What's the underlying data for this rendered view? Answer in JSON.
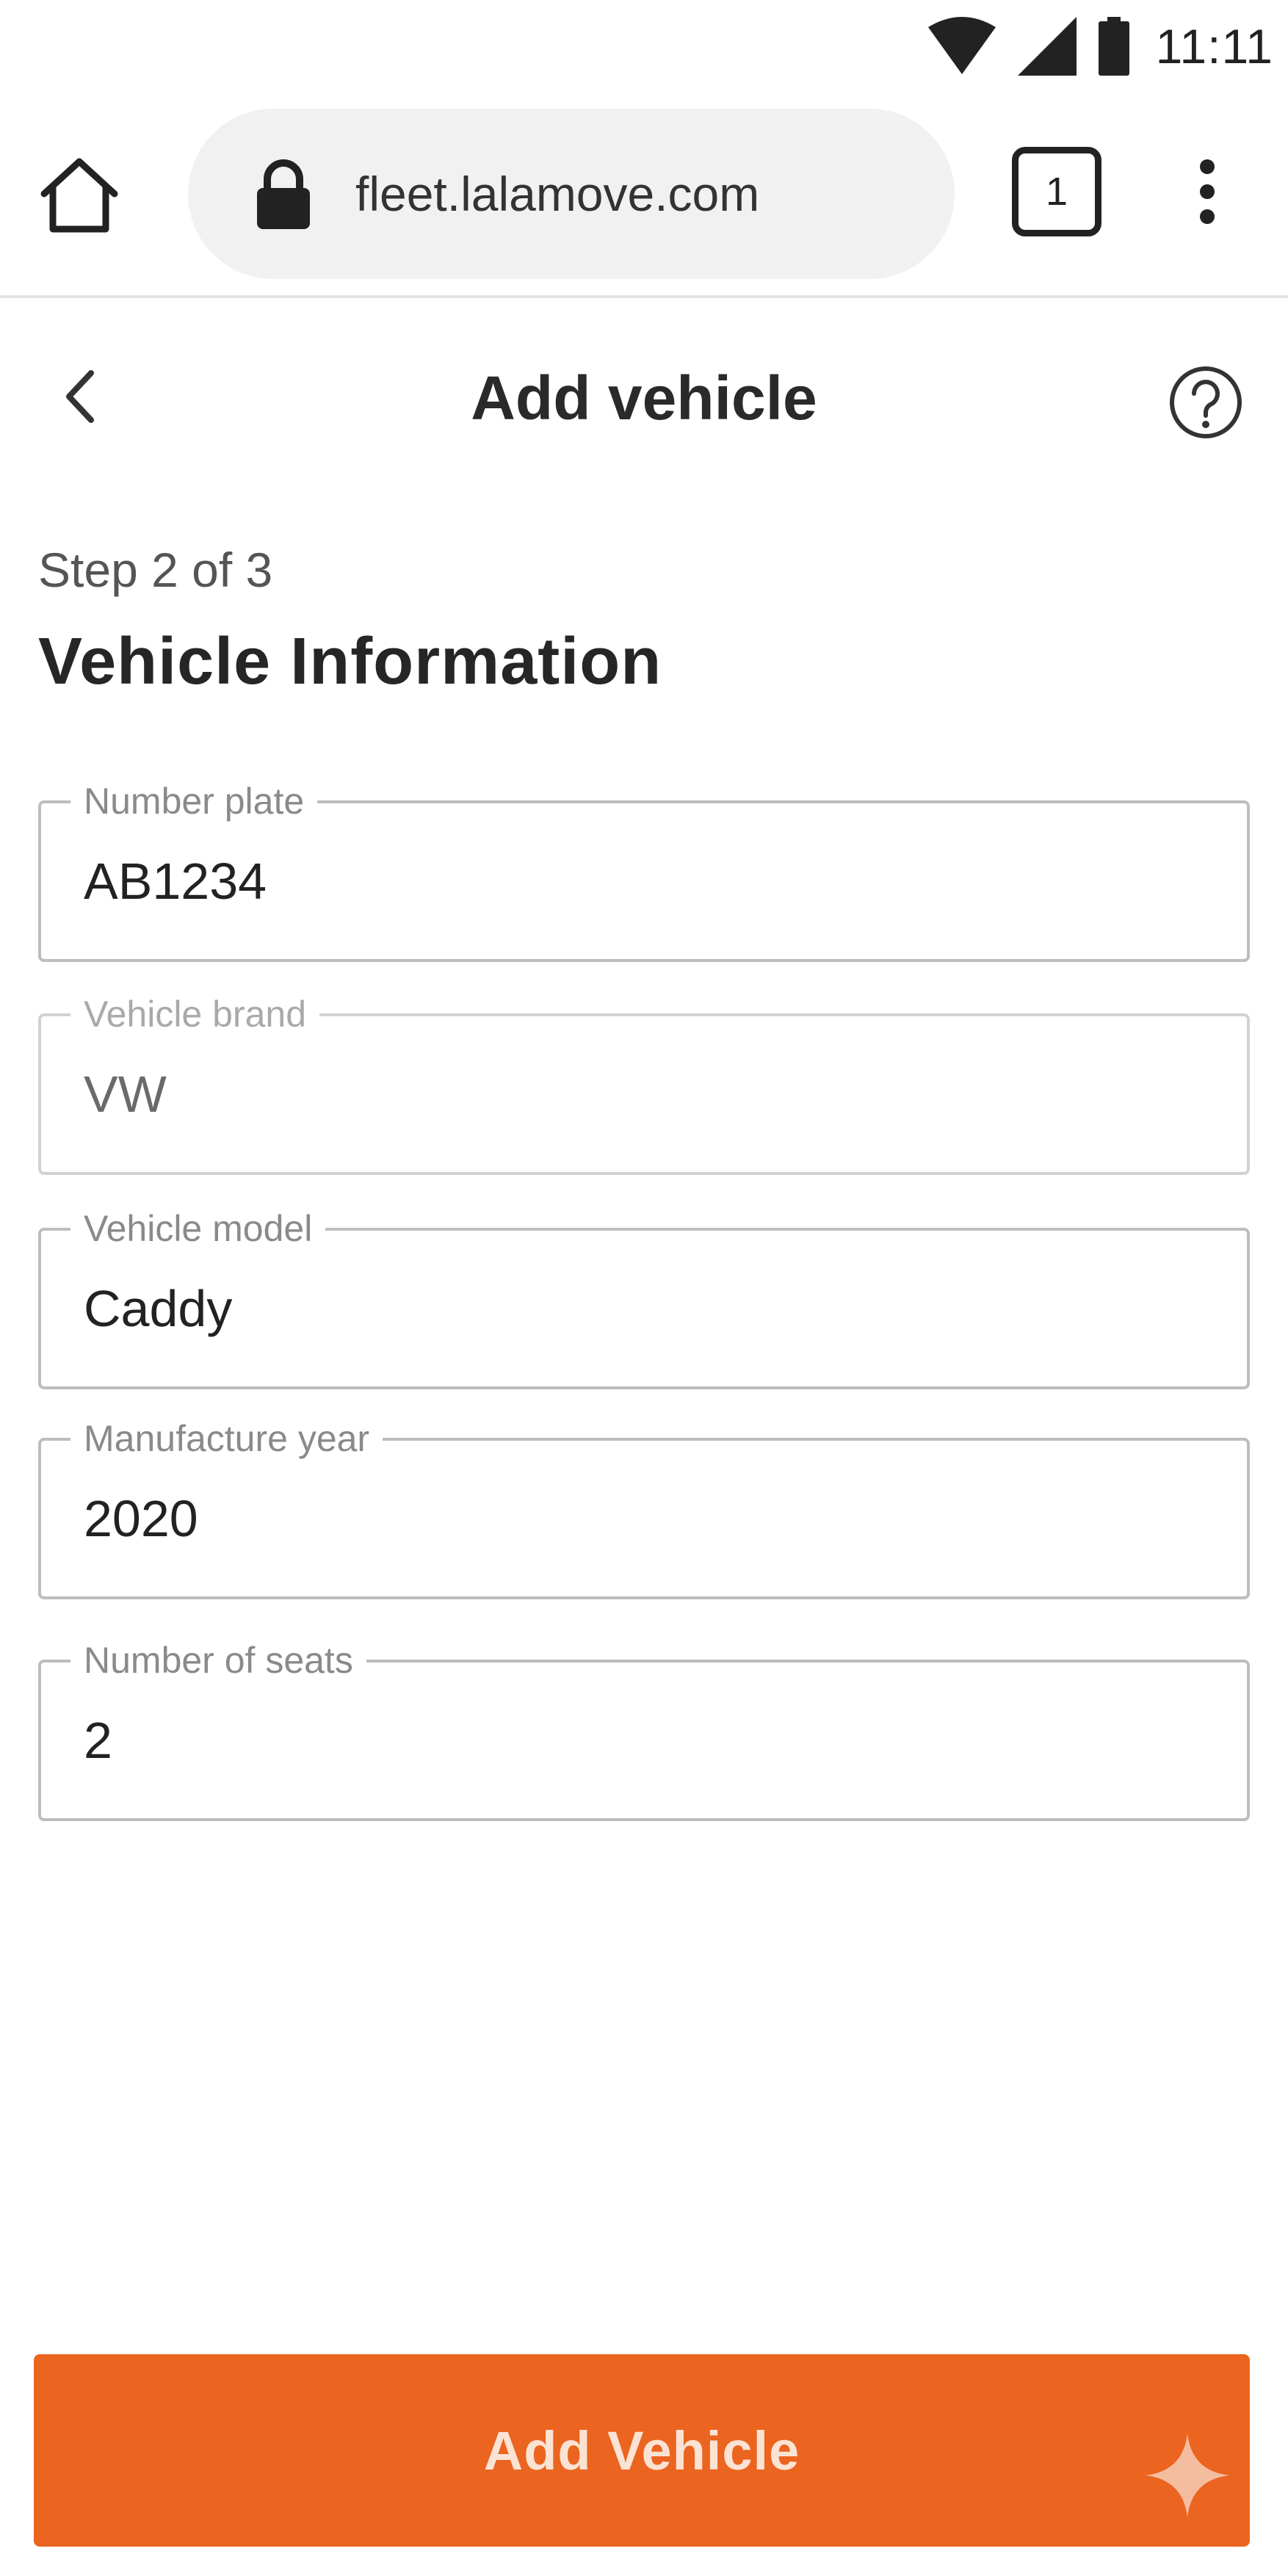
{
  "status_bar": {
    "time": "11:11",
    "icons": [
      "wifi-icon",
      "signal-icon",
      "battery-icon"
    ]
  },
  "browser": {
    "url": "fleet.lalamove.com",
    "tab_count": "1",
    "icons": [
      "home-icon",
      "lock-icon",
      "more-vert-icon"
    ]
  },
  "header": {
    "title": "Add vehicle",
    "back_icon": "chevron-left-icon",
    "help_icon": "help-circle-icon"
  },
  "step": {
    "label": "Step 2 of 3",
    "section_title": "Vehicle Information"
  },
  "form": {
    "fields": [
      {
        "label": "Number plate",
        "value": "AB1234"
      },
      {
        "label": "Vehicle brand",
        "value": "VW"
      },
      {
        "label": "Vehicle model",
        "value": "Caddy"
      },
      {
        "label": "Manufacture year",
        "value": "2020"
      },
      {
        "label": "Number of seats",
        "value": "2"
      }
    ]
  },
  "submit": {
    "label": "Add Vehicle",
    "icon": "sparkle-icon"
  },
  "colors": {
    "accent": "#eb6420",
    "text_primary": "#222222",
    "field_border": "#bdbdbd",
    "field_label": "#8a8a8a",
    "url_pill": "#f1f1f1"
  }
}
